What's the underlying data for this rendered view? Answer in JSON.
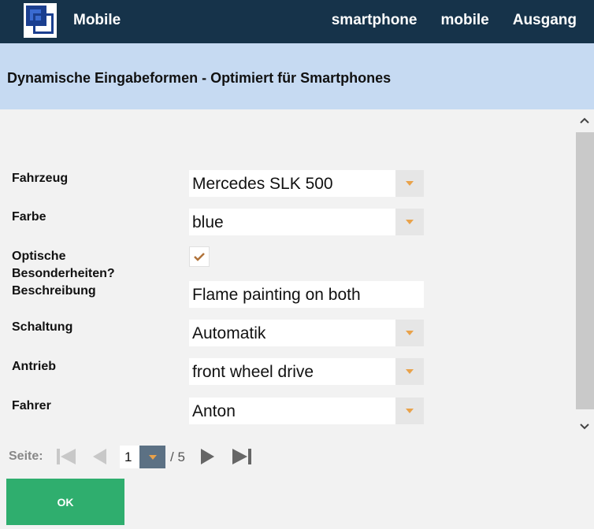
{
  "app": {
    "title": "Mobile"
  },
  "nav": {
    "items": [
      "smartphone",
      "mobile",
      "Ausgang"
    ]
  },
  "page": {
    "title": "Dynamische Eingabeformen - Optimiert für Smartphones"
  },
  "form": {
    "fahrzeug": {
      "label": "Fahrzeug",
      "value": "Mercedes SLK 500"
    },
    "farbe": {
      "label": "Farbe",
      "value": "blue"
    },
    "optische": {
      "label_line1": "Optische",
      "label_line2": "Besonderheiten?",
      "checked": true
    },
    "beschreibung": {
      "label": "Beschreibung",
      "value": "Flame painting on both"
    },
    "schaltung": {
      "label": "Schaltung",
      "value": "Automatik"
    },
    "antrieb": {
      "label": "Antrieb",
      "value": "front wheel drive"
    },
    "fahrer": {
      "label": "Fahrer",
      "value": "Anton"
    }
  },
  "pager": {
    "label": "Seite:",
    "current": "1",
    "total": "/ 5"
  },
  "actions": {
    "ok_label": "OK"
  },
  "colors": {
    "topbar": "#16334a",
    "header_band": "#c6daf2",
    "accent_orange": "#e9a24a",
    "ok_green": "#2fae6e"
  },
  "icons": [
    "logo-icon",
    "chevron-up-icon",
    "chevron-down-icon",
    "dropdown-arrow-icon",
    "checkmark-icon",
    "first-page-icon",
    "previous-page-icon",
    "next-page-icon",
    "last-page-icon"
  ]
}
